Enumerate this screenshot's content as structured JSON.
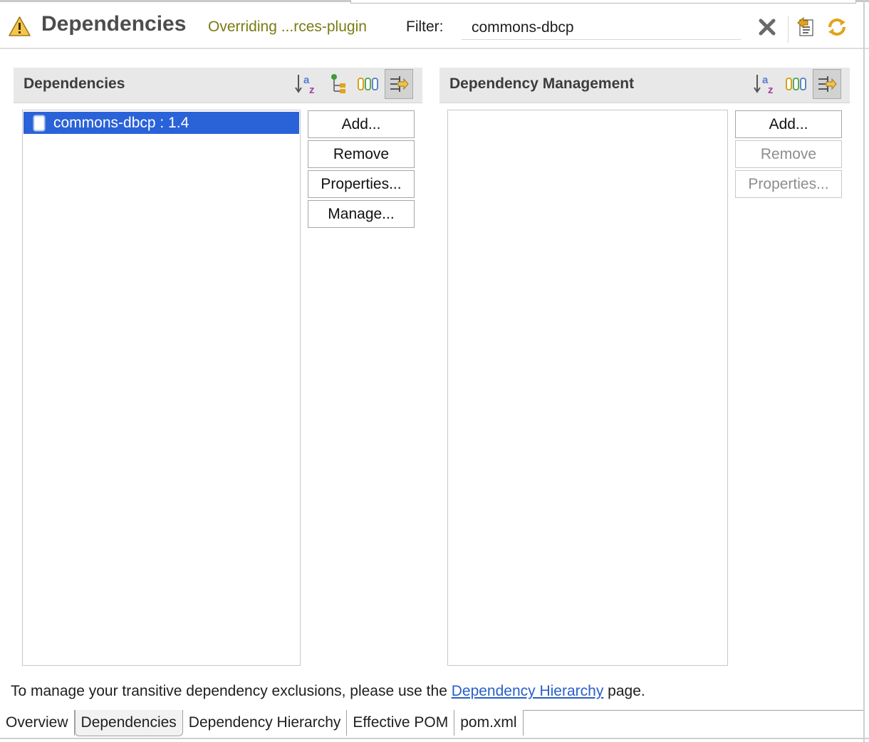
{
  "header": {
    "title": "Dependencies",
    "status": "Overriding ...rces-plugin",
    "filter_label": "Filter:",
    "filter_value": "commons-dbcp"
  },
  "dependencies": {
    "title": "Dependencies",
    "items": [
      "commons-dbcp : 1.4"
    ],
    "buttons": {
      "add": "Add...",
      "remove": "Remove",
      "properties": "Properties...",
      "manage": "Manage..."
    }
  },
  "dependency_management": {
    "title": "Dependency Management",
    "items": [],
    "buttons": {
      "add": "Add...",
      "remove": "Remove",
      "properties": "Properties..."
    }
  },
  "footer": {
    "note_before": "To manage your transitive dependency exclusions, please use the ",
    "note_link": "Dependency Hierarchy",
    "note_after": " page."
  },
  "tabs": [
    {
      "label": "Overview",
      "active": false
    },
    {
      "label": "Dependencies",
      "active": true
    },
    {
      "label": "Dependency Hierarchy",
      "active": false
    },
    {
      "label": "Effective POM",
      "active": false
    },
    {
      "label": "pom.xml",
      "active": false
    }
  ],
  "colors": {
    "selection": "#2a62d8",
    "status_text": "#7b7b13",
    "link": "#2860c8"
  },
  "icons": {
    "warning": "warning-icon",
    "clear_filter": "clear-filter-icon",
    "edit_pom": "edit-pom-icon",
    "refresh": "refresh-icon",
    "sort": "sort-alpha-icon",
    "tree": "hierarchy-icon",
    "columns": "show-group-id-icon",
    "filter_toggle": "filter-toggle-icon"
  }
}
